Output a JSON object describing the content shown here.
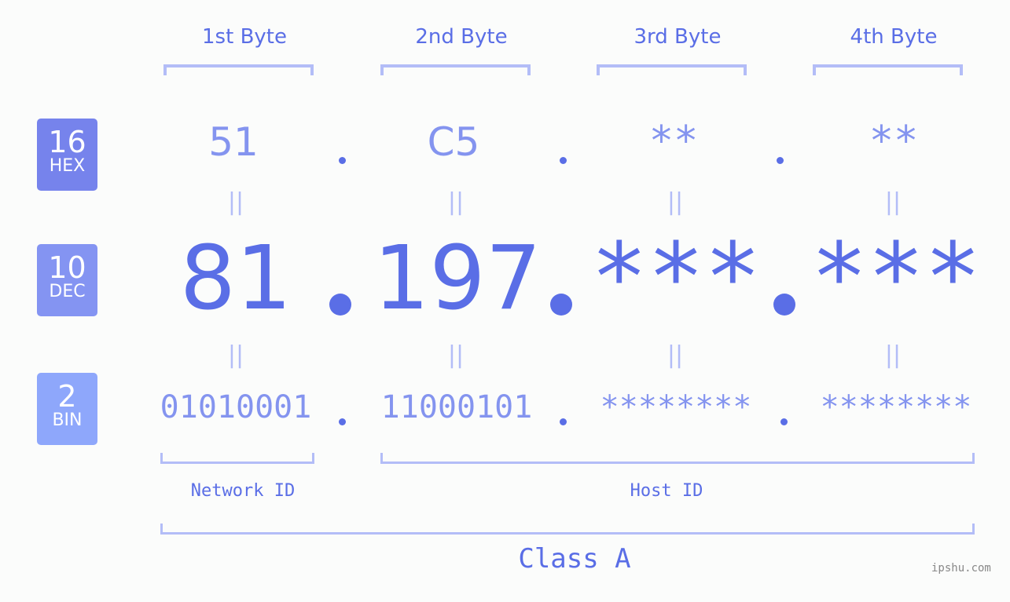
{
  "headers": [
    "1st Byte",
    "2nd Byte",
    "3rd Byte",
    "4th Byte"
  ],
  "badges": {
    "hex": {
      "number": "16",
      "label": "HEX",
      "color": "#7683ec"
    },
    "dec": {
      "number": "10",
      "label": "DEC",
      "color": "#8494f2"
    },
    "bin": {
      "number": "2",
      "label": "BIN",
      "color": "#8ea7fb"
    }
  },
  "hex": [
    "51",
    "C5",
    "**",
    "**"
  ],
  "dec": [
    "81",
    "197",
    "***",
    "***"
  ],
  "bin": [
    "01010001",
    "11000101",
    "********",
    "********"
  ],
  "equals_symbol": "||",
  "segments": {
    "network": "Network ID",
    "host": "Host ID"
  },
  "class_label": "Class A",
  "watermark": "ipshu.com",
  "colors": {
    "accent": "#5a6ee6",
    "light_accent": "#8494ef",
    "bracket": "#b3bdf7",
    "background": "#fbfcfb"
  }
}
